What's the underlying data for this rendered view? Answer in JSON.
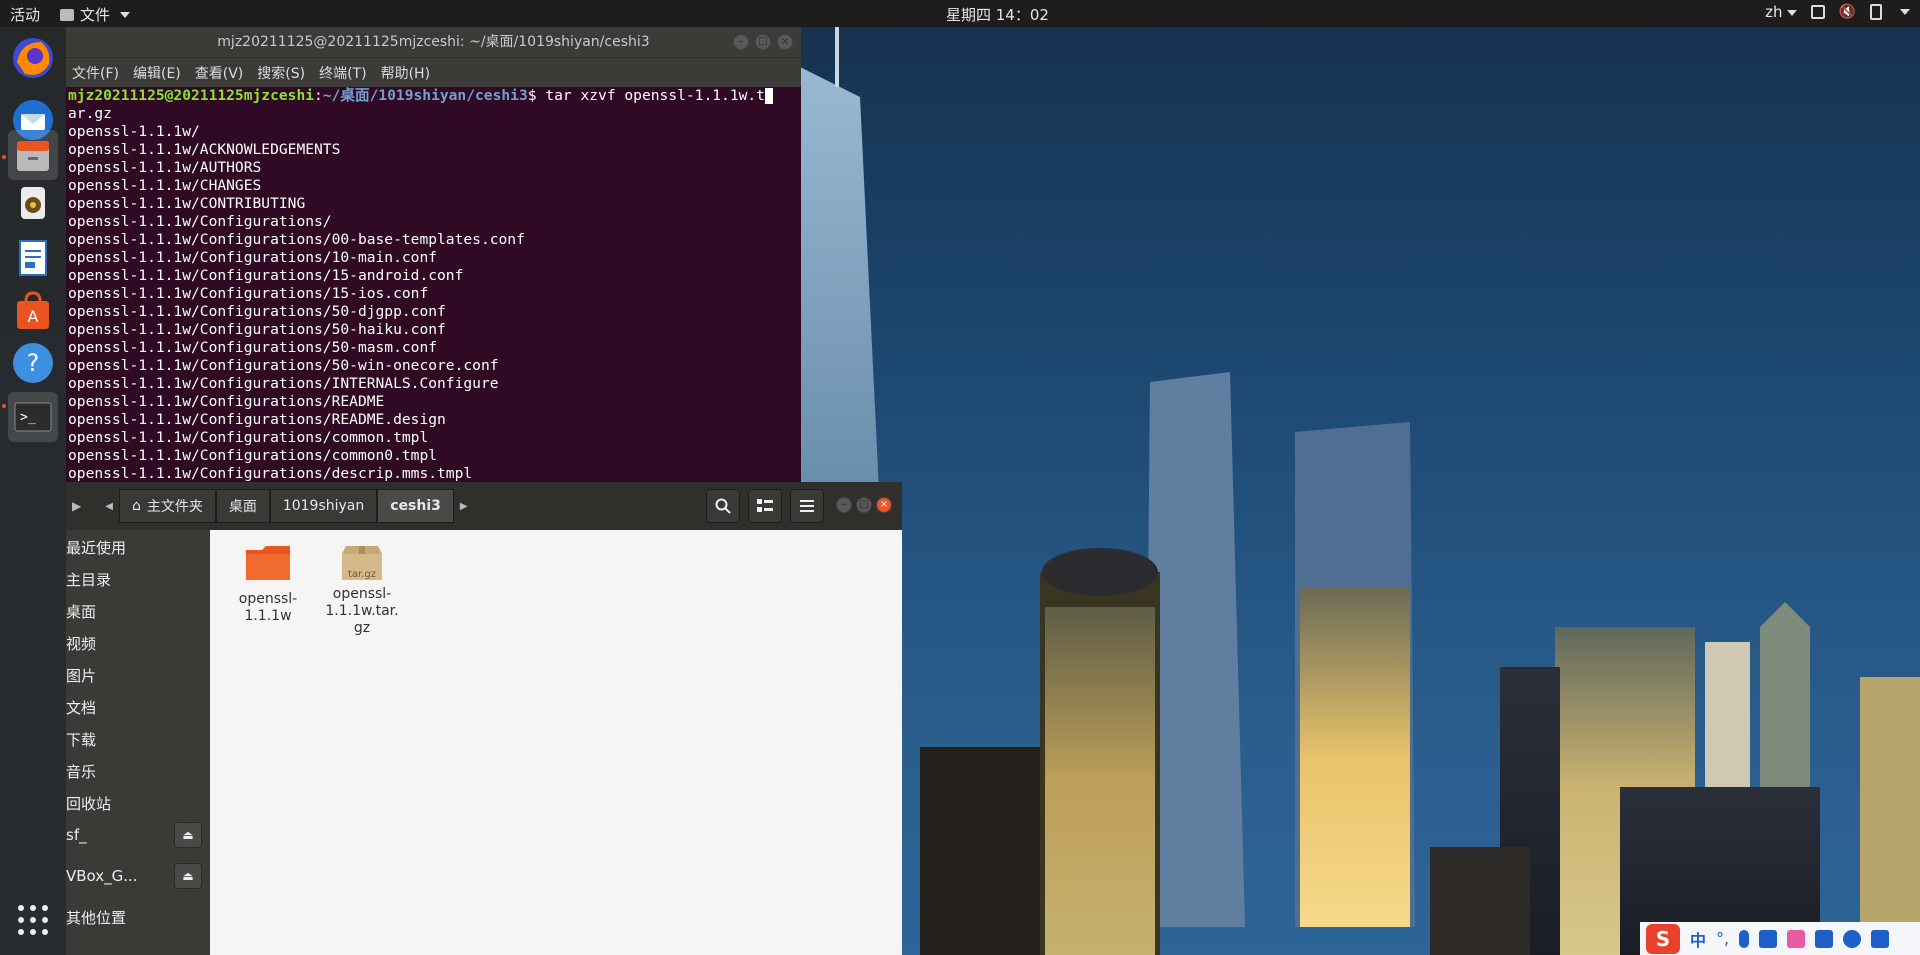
{
  "topbar": {
    "activities": "活动",
    "app_menu": "文件",
    "clock": "星期四 14：02",
    "input_method": "zh"
  },
  "dock": {
    "items": [
      "firefox-icon",
      "thunderbird-icon",
      "files-icon",
      "rhythmbox-icon",
      "writer-icon",
      "software-center-icon",
      "help-icon",
      "terminal-icon",
      "show-apps-icon"
    ]
  },
  "terminal": {
    "title": "mjz20211125@20211125mjzceshi: ~/桌面/1019shiyan/ceshi3",
    "menus": [
      "文件(F)",
      "编辑(E)",
      "查看(V)",
      "搜索(S)",
      "终端(T)",
      "帮助(H)"
    ],
    "prompt_user": "mjz20211125@20211125mjzceshi",
    "prompt_sep": ":",
    "prompt_path": "~/桌面/1019shiyan/ceshi3",
    "prompt_dollar": "$ ",
    "command": "tar xzvf openssl-1.1.1w.t",
    "command_wrap": "ar.gz",
    "lines": [
      "openssl-1.1.1w/",
      "openssl-1.1.1w/ACKNOWLEDGEMENTS",
      "openssl-1.1.1w/AUTHORS",
      "openssl-1.1.1w/CHANGES",
      "openssl-1.1.1w/CONTRIBUTING",
      "openssl-1.1.1w/Configurations/",
      "openssl-1.1.1w/Configurations/00-base-templates.conf",
      "openssl-1.1.1w/Configurations/10-main.conf",
      "openssl-1.1.1w/Configurations/15-android.conf",
      "openssl-1.1.1w/Configurations/15-ios.conf",
      "openssl-1.1.1w/Configurations/50-djgpp.conf",
      "openssl-1.1.1w/Configurations/50-haiku.conf",
      "openssl-1.1.1w/Configurations/50-masm.conf",
      "openssl-1.1.1w/Configurations/50-win-onecore.conf",
      "openssl-1.1.1w/Configurations/INTERNALS.Configure",
      "openssl-1.1.1w/Configurations/README",
      "openssl-1.1.1w/Configurations/README.design",
      "openssl-1.1.1w/Configurations/common.tmpl",
      "openssl-1.1.1w/Configurations/common0.tmpl",
      "openssl-1.1.1w/Configurations/descrip.mms.tmpl"
    ]
  },
  "file_manager": {
    "breadcrumb": [
      "主文件夹",
      "桌面",
      "1019shiyan",
      "ceshi3"
    ],
    "sidebar": [
      {
        "label": "最近使用",
        "icon": "clock-icon"
      },
      {
        "label": "主目录",
        "icon": "home-icon"
      },
      {
        "label": "桌面",
        "icon": "desktop-icon"
      },
      {
        "label": "视频",
        "icon": "video-icon"
      },
      {
        "label": "图片",
        "icon": "camera-icon"
      },
      {
        "label": "文档",
        "icon": "document-icon"
      },
      {
        "label": "下载",
        "icon": "download-icon"
      },
      {
        "label": "音乐",
        "icon": "music-icon"
      },
      {
        "label": "回收站",
        "icon": "trash-icon"
      },
      {
        "label": "sf_",
        "icon": "drive-icon"
      },
      {
        "label": "VBox_G...",
        "icon": "disc-icon"
      },
      {
        "label": "其他位置",
        "icon": "plus-icon"
      }
    ],
    "files": [
      {
        "name": "openssl-\n1.1.1w",
        "type": "folder"
      },
      {
        "name": "openssl-\n1.1.1w.tar.\ngz",
        "type": "archive",
        "badge": "tar.gz"
      }
    ]
  },
  "tray": {
    "ime_label": "中"
  }
}
